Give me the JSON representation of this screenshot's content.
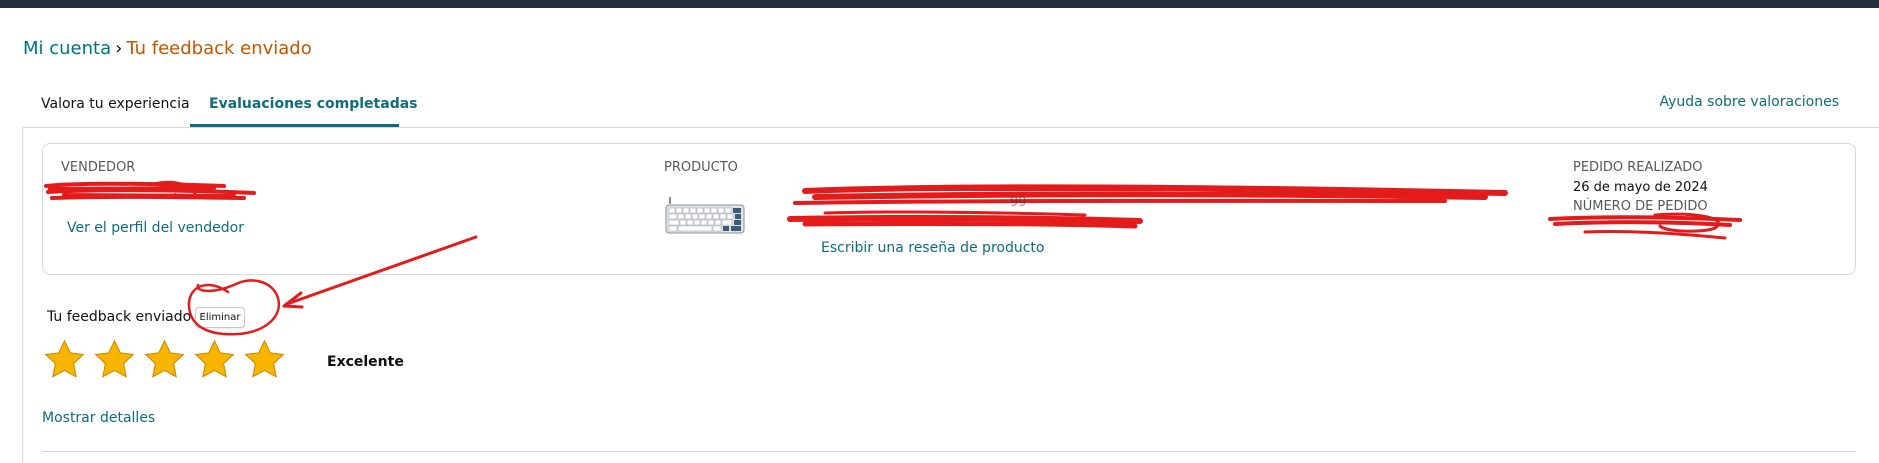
{
  "breadcrumb": {
    "parent": "Mi cuenta",
    "separator": "›",
    "current": "Tu feedback enviado"
  },
  "tabs": [
    {
      "label": "Valora tu experiencia",
      "active": false
    },
    {
      "label": "Evaluaciones completadas",
      "active": true
    }
  ],
  "help_link": "Ayuda sobre valoraciones",
  "card": {
    "vendor_label": "VENDEDOR",
    "vendor_profile_link": "Ver el perfil del vendedor",
    "product_label": "PRODUCTO",
    "product_icon": "keyboard-thumbnail",
    "write_review_link": "Escribir una reseña de producto",
    "order_placed_label": "PEDIDO REALIZADO",
    "order_date": "26 de mayo de 2024",
    "order_number_label": "NÚMERO DE PEDIDO"
  },
  "feedback": {
    "label": "Tu feedback enviado",
    "delete_button": "Eliminar",
    "stars": 5,
    "stars_max": 5,
    "rating_text": "Excelente",
    "show_details": "Mostrar detalles"
  },
  "colors": {
    "link": "#0f6c7c",
    "breadcrumb_current": "#c45500",
    "star": "#f7b500",
    "annotation_red": "#e31b1b",
    "topbar": "#232f3e"
  }
}
